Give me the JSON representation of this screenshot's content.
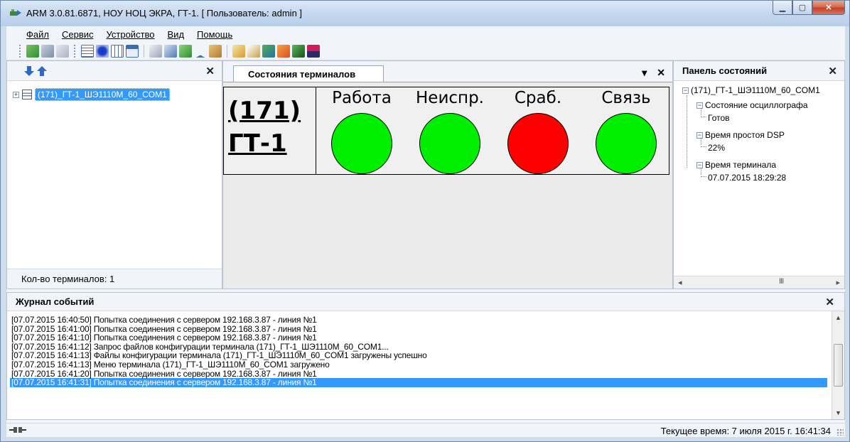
{
  "window": {
    "title": "ARM 3.0.81.6871, НОУ НОЦ ЭКРА, ГТ-1. [ Пользователь: admin ]"
  },
  "menu": [
    "Файл",
    "Сервис",
    "Устройство",
    "Вид",
    "Помощь"
  ],
  "toolbar": {
    "icons": [
      "add-terminal-icon",
      "remove-terminal-icon",
      "terminal-properties-icon",
      "list-view-icon",
      "indicator-view-icon",
      "table-view-icon",
      "window-dropdown-icon",
      "settings-icon",
      "config-icon",
      "tree-icon",
      "filter-icon",
      "tools-icon",
      "oscillogram-icon",
      "edit-icon",
      "download-icon",
      "event-icon",
      "refresh-icon",
      "flag-icon"
    ]
  },
  "left_panel": {
    "terminal_item": "(171)_ГТ-1_ШЭ1110М_60_COM1",
    "footer": "Кол-во терминалов: 1"
  },
  "center_panel": {
    "tab_label": "Состояния терминалов",
    "terminal": {
      "name_line1": "(171)",
      "name_line2": "ГТ-1"
    },
    "indicators": [
      {
        "label": "Работа",
        "color": "#00ee00"
      },
      {
        "label": "Неиспр.",
        "color": "#00ee00"
      },
      {
        "label": "Сраб.",
        "color": "#ff0000"
      },
      {
        "label": "Связь",
        "color": "#00ee00"
      }
    ]
  },
  "right_panel": {
    "title": "Панель состояний",
    "root": "(171)_ГТ-1_ШЭ1110М_60_COM1",
    "nodes": [
      {
        "label": "Состояние осциллографа",
        "value": "Готов"
      },
      {
        "label": "Время простоя DSP",
        "value": "22%"
      },
      {
        "label": "Время терминала",
        "value": "07.07.2015 18:29:28"
      }
    ],
    "scroll_thumb": "III"
  },
  "event_log": {
    "title": "Журнал событий",
    "lines": [
      "[07.07.2015 16:40:50] Попытка соединения с сервером 192.168.3.87 - линия №1",
      "[07.07.2015 16:41:00] Попытка соединения с сервером 192.168.3.87 - линия №1",
      "[07.07.2015 16:41:10] Попытка соединения с сервером 192.168.3.87 - линия №1",
      "[07.07.2015 16:41:12] Запрос файлов конфигурации терминала (171)_ГТ-1_ШЭ1110М_60_COM1...",
      "[07.07.2015 16:41:13] Файлы конфигурации терминала (171)_ГТ-1_ШЭ1110М_60_COM1 загружены успешно",
      "[07.07.2015 16:41:13] Меню терминала (171)_ГТ-1_ШЭ1110М_60_COM1 загружено",
      "[07.07.2015 16:41:20] Попытка соединения с сервером 192.168.3.87 - линия №1",
      "[07.07.2015 16:41:31] Попытка соединения с сервером 192.168.3.87 - линия №1"
    ],
    "selected_index": 7
  },
  "statusbar": {
    "time": "Текущее время: 7 июля 2015 г. 16:41:34"
  },
  "colors": {
    "selection": "#3399ff",
    "ok": "#00ee00",
    "alarm": "#ff0000"
  }
}
